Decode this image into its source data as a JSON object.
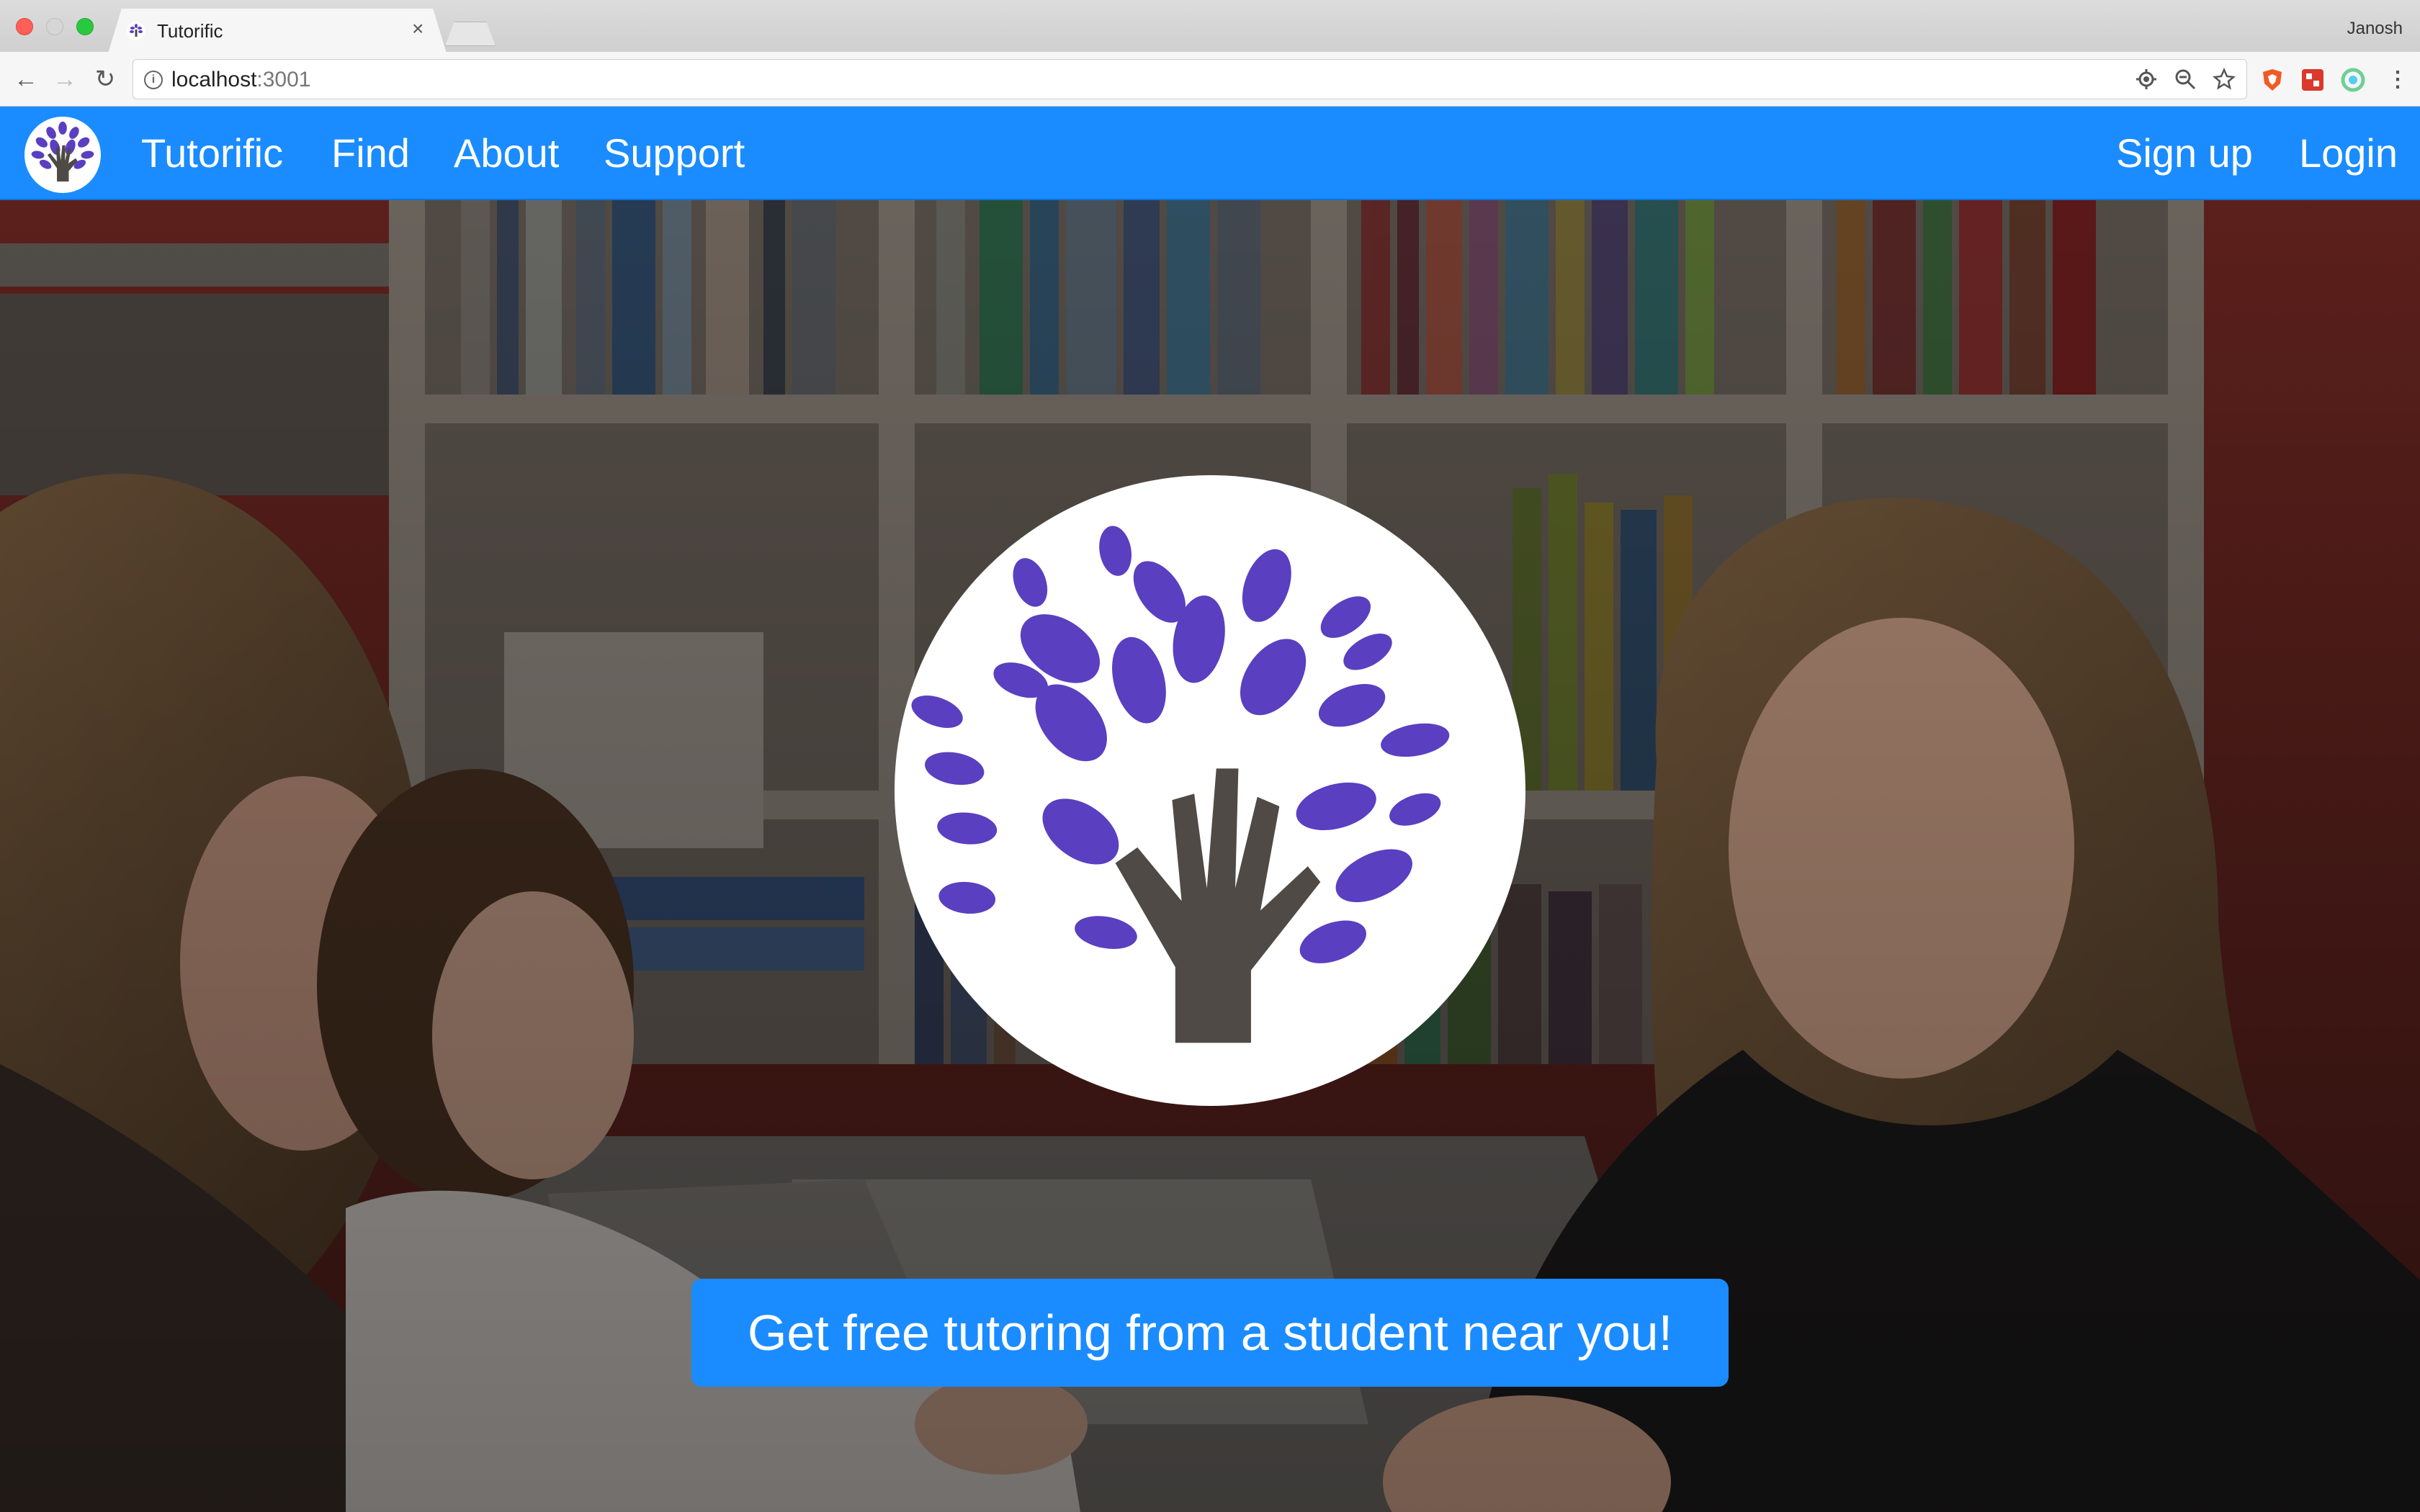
{
  "browser": {
    "tab_title": "Tutorific",
    "tab_close": "×",
    "profile": "Janosh",
    "url_host": "localhost",
    "url_port": ":3001"
  },
  "navbar": {
    "brand": "Tutorific",
    "links": [
      "Find",
      "About",
      "Support"
    ],
    "right_links": [
      "Sign up",
      "Login"
    ]
  },
  "hero": {
    "cta_label": "Get free tutoring from a student near you!"
  },
  "colors": {
    "primary": "#1a8cff",
    "leaf": "#5a3fc0",
    "hand": "#4f4a45"
  }
}
